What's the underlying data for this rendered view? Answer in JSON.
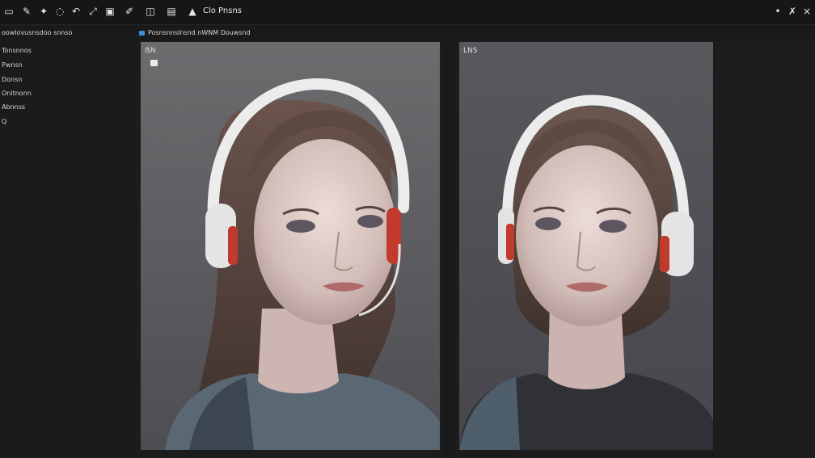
{
  "toolbar": {
    "title": "Clo Pnsns",
    "tools": [
      {
        "name": "layout-icon",
        "glyph": "▭"
      },
      {
        "name": "pen-icon",
        "glyph": "✎"
      },
      {
        "name": "brush-icon",
        "glyph": "✦"
      },
      {
        "name": "lasso-icon",
        "glyph": "◌"
      },
      {
        "name": "undo-icon",
        "glyph": "↶"
      },
      {
        "name": "move-icon",
        "glyph": "⤢"
      },
      {
        "name": "frame-icon",
        "glyph": "▣"
      },
      {
        "name": "pencil-icon",
        "glyph": "✐"
      },
      {
        "name": "crop-icon",
        "glyph": "◫"
      },
      {
        "name": "image-icon",
        "glyph": "▤"
      },
      {
        "name": "stamp-icon",
        "glyph": "▲"
      }
    ],
    "right_tools": [
      {
        "name": "dot-icon",
        "glyph": "•"
      },
      {
        "name": "tools-icon",
        "glyph": "✗"
      },
      {
        "name": "close-icon",
        "glyph": "×"
      }
    ]
  },
  "subbar": {
    "left_label": "oowlovusnsdoo snnso",
    "doc_tab": "Posnsnnslnsnd nWNM Douwsnd"
  },
  "sidebar": {
    "items": [
      "Tonsnnos",
      "Pwnsn",
      "Donsn",
      "Onitnonn",
      "Abnnss",
      "Q"
    ]
  },
  "panels": {
    "left": {
      "label": "ẞN"
    },
    "right": {
      "label": "LNS"
    }
  },
  "colors": {
    "accent": "#3a8fd6",
    "background": "#1c1c1d",
    "headphone_accent": "#c23a2e"
  }
}
